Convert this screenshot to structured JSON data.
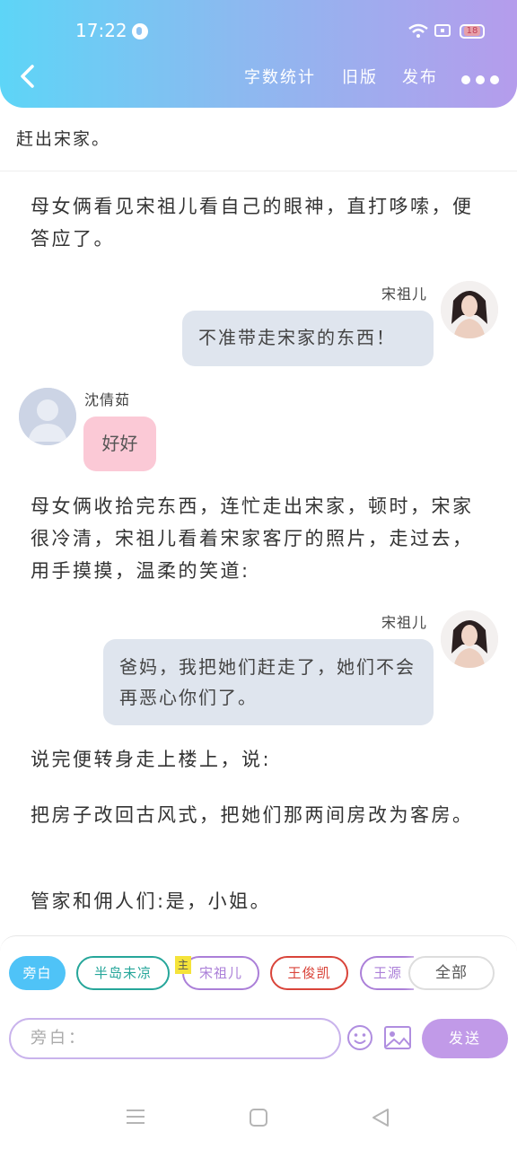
{
  "status": {
    "time": "17:22",
    "battery": "18"
  },
  "header": {
    "nav": [
      "字数统计",
      "旧版",
      "发布"
    ]
  },
  "content": {
    "top_line": "赶出宋家。",
    "para1": "母女俩看见宋祖儿看自己的眼神，直打哆嗦，便答应了。",
    "msg1": {
      "speaker": "宋祖儿",
      "text": "不准带走宋家的东西！"
    },
    "msg2": {
      "speaker": "沈倩茹",
      "text": "好好"
    },
    "para2": "母女俩收拾完东西，连忙走出宋家，顿时，宋家很冷清，宋祖儿看着宋家客厅的照片，走过去，用手摸摸，温柔的笑道:",
    "msg3": {
      "speaker": "宋祖儿",
      "text": "爸妈，我把她们赶走了，她们不会再恶心你们了。"
    },
    "para3": "说完便转身走上楼上，说:",
    "para4": "把房子改回古风式，把她们那两间房改为客房。",
    "para5": "管家和佣人们:是，小姐。"
  },
  "roles": {
    "items": [
      {
        "label": "旁白",
        "color": "#4fc3f7"
      },
      {
        "label": "半岛未凉",
        "color": "#26a69a"
      },
      {
        "label": "宋祖儿",
        "color": "#ab7fd8"
      },
      {
        "label": "王俊凯",
        "color": "#d9443a"
      },
      {
        "label": "王源",
        "color": "#ab7fd8"
      }
    ],
    "master_tag": "主",
    "all_label": "全部"
  },
  "composer": {
    "placeholder": "旁白：",
    "send_label": "发送"
  }
}
